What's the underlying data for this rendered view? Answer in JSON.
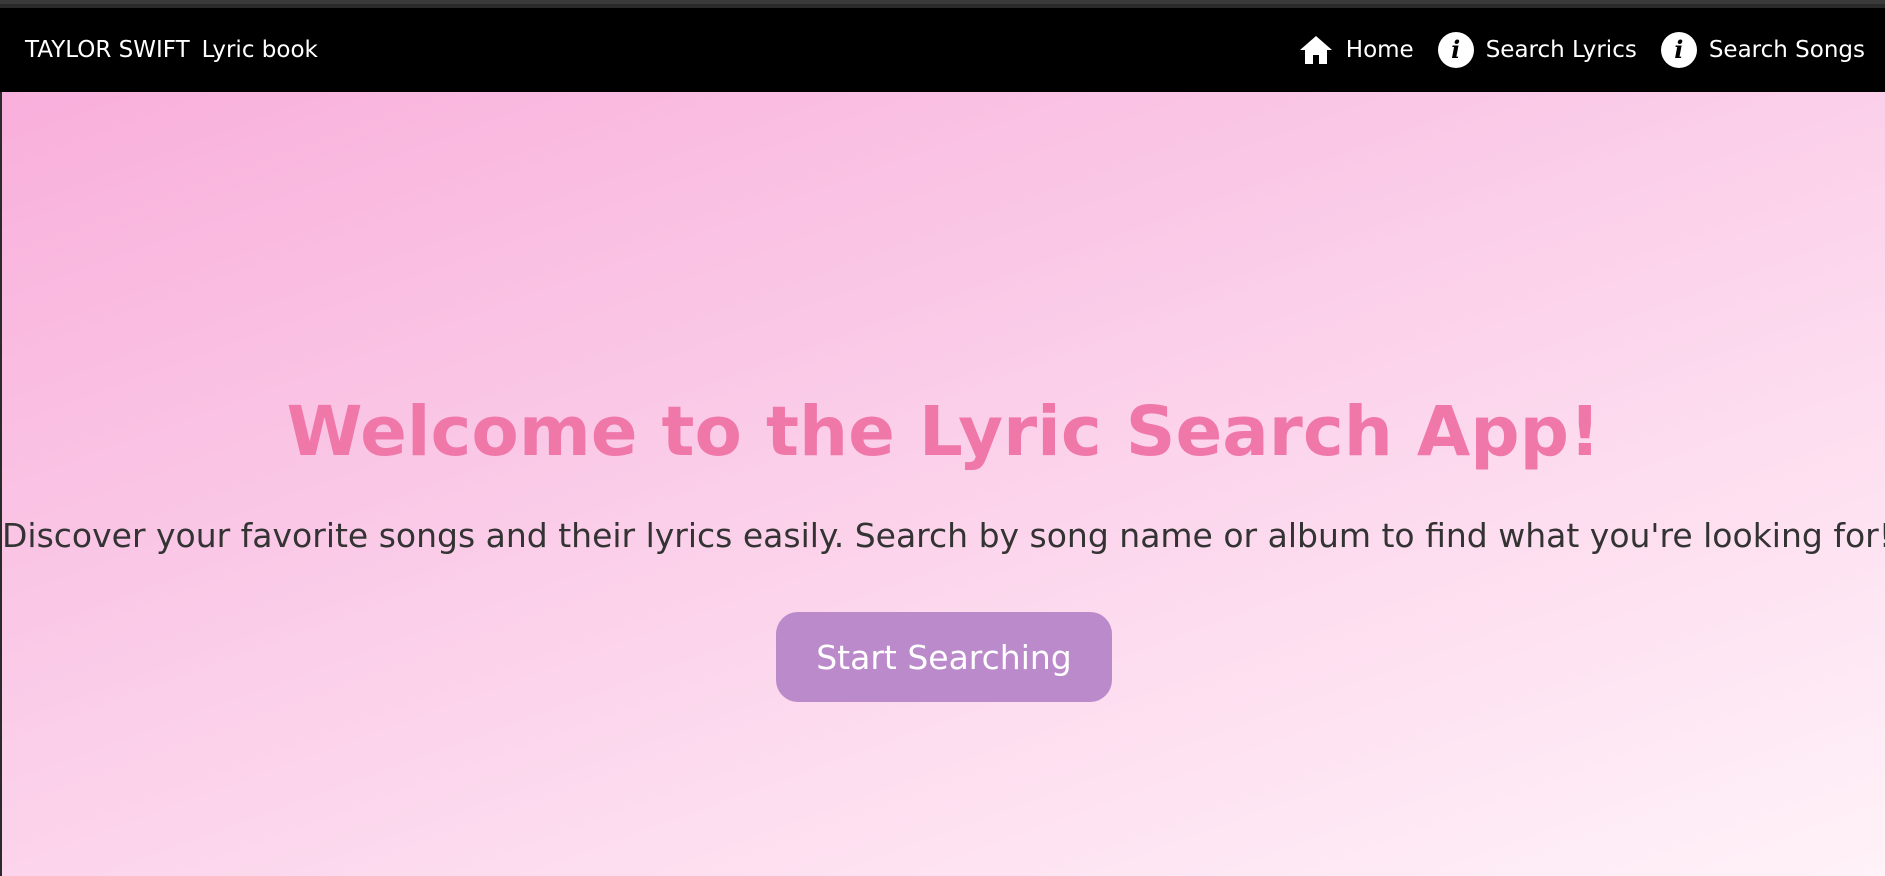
{
  "navbar": {
    "brand": "TAYLOR SWIFT",
    "brand_sub": "Lyric book",
    "links": [
      {
        "label": "Home",
        "icon": "home-icon"
      },
      {
        "label": "Search Lyrics",
        "icon": "info-icon"
      },
      {
        "label": "Search Songs",
        "icon": "info-icon"
      }
    ]
  },
  "hero": {
    "title": "Welcome to the Lyric Search App!",
    "subtitle": "Discover your favorite songs and their lyrics easily. Search by song name or album to find what you're looking for!",
    "cta_label": "Start Searching"
  },
  "colors": {
    "navbar_bg": "#000000",
    "title": "#ef78a9",
    "button": "#bb8acb",
    "gradient_start": "#f9afdb",
    "gradient_end": "#fff2f8"
  }
}
